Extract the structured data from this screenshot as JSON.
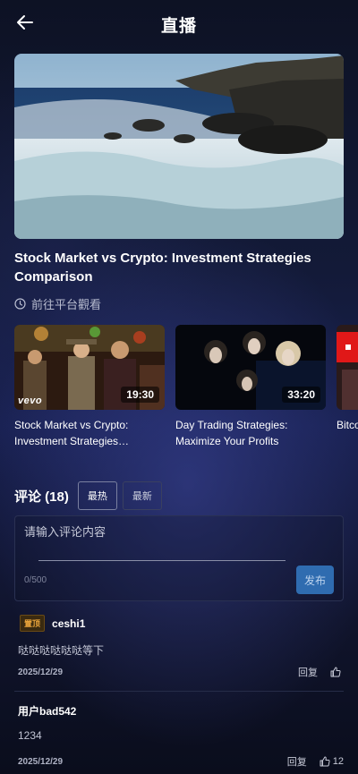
{
  "header": {
    "title": "直播",
    "back_icon": "arrow-left-icon"
  },
  "video": {
    "title": "Stock Market vs Crypto: Investment Strategies Comparison",
    "platform_link_label": "前往平台觀看",
    "platform_icon": "clock-icon"
  },
  "related": [
    {
      "title": "Stock Market vs Crypto: Investment Strategies…",
      "duration": "19:30",
      "badge": "vevo"
    },
    {
      "title": "Day Trading Strategies: Maximize Your Profits",
      "duration": "33:20"
    },
    {
      "title": "Bitco… Marke…",
      "duration": ""
    }
  ],
  "comments": {
    "title": "评论 (18)",
    "sort_hot": "最热",
    "sort_new": "最新",
    "input_placeholder": "请输入评论内容",
    "char_count": "0/500",
    "publish_label": "发布",
    "items": [
      {
        "pinned_label": "置顶",
        "user": "ceshi1",
        "text": "哒哒哒哒哒哒等下",
        "date": "2025/12/29",
        "reply_label": "回复",
        "likes": ""
      },
      {
        "user": "用户bad542",
        "text": "1234",
        "date": "2025/12/29",
        "reply_label": "回复",
        "likes": "12"
      }
    ]
  },
  "colors": {
    "accent": "#2f6cb0",
    "pinned": "#e8a33a",
    "background": "#131a38"
  }
}
